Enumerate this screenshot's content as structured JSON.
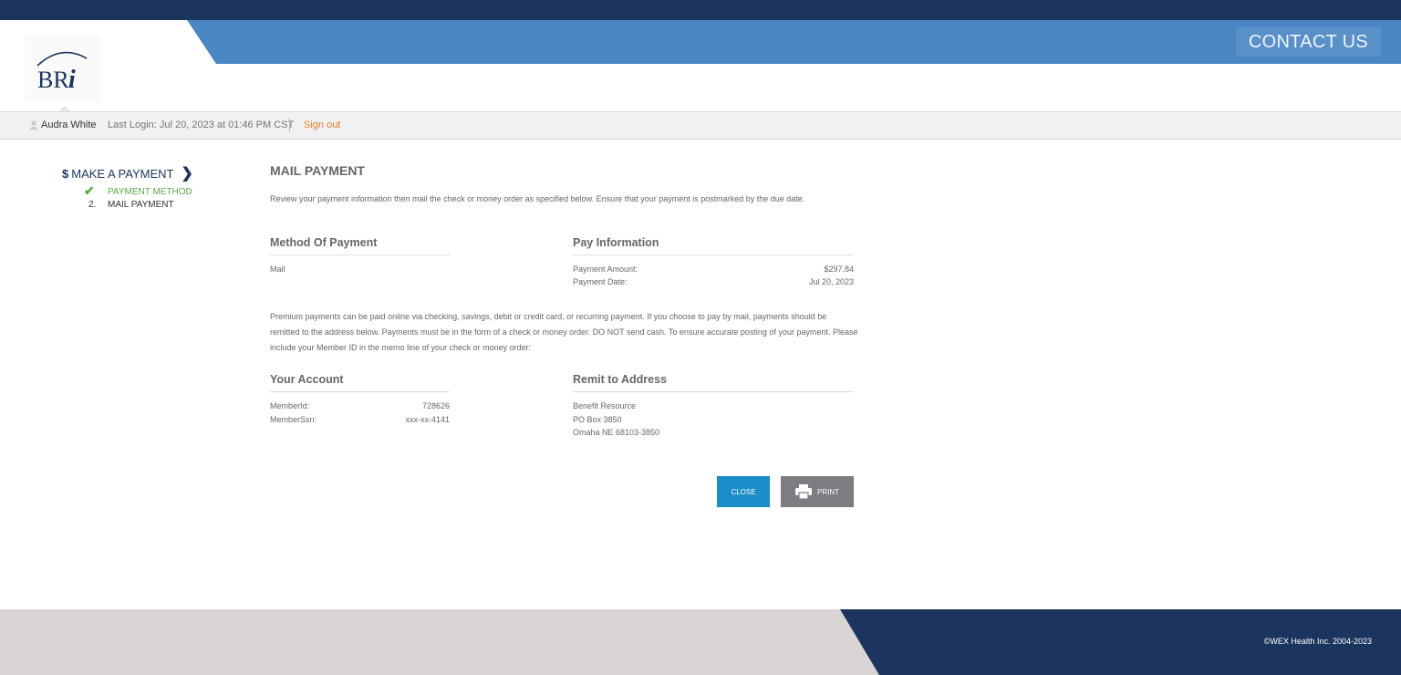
{
  "header": {
    "contact_label": "CONTACT US",
    "logo_text": "BRi"
  },
  "userbar": {
    "user_name": "Audra White",
    "last_login": "Last Login: Jul 20, 2023 at 01:46 PM CST",
    "sign_out": "Sign out"
  },
  "sidebar": {
    "dollar": "$",
    "heading": "MAKE A PAYMENT",
    "steps": [
      {
        "marker": "✔",
        "label": "PAYMENT METHOD"
      },
      {
        "marker": "2.",
        "label": "MAIL PAYMENT"
      }
    ]
  },
  "main": {
    "title": "MAIL PAYMENT",
    "intro": "Review your payment information then mail the check or money order as specified below. Ensure that your payment is postmarked by the due date.",
    "method": {
      "heading": "Method Of Payment",
      "value": "Mail"
    },
    "pay_info": {
      "heading": "Pay Information",
      "amount_label": "Payment Amount:",
      "amount_value": "$297.84",
      "date_label": "Payment Date:",
      "date_value": "Jul 20, 2023"
    },
    "paragraph": "Premium payments can be paid online via checking, savings, debit or credit card, or recurring payment. If you choose to pay by mail, payments should be remitted to the address below. Payments must be in the form of a check or money order. DO NOT send cash. To ensure accurate posting of your payment. Please include your Member ID in the memo line of your check or money order:",
    "account": {
      "heading": "Your Account",
      "member_id_label": "MemberId:",
      "member_id_value": "728626",
      "member_ssn_label": "MemberSsn:",
      "member_ssn_value": "xxx-xx-4141"
    },
    "remit": {
      "heading": "Remit to Address",
      "line1": "Benefit Resource",
      "line2": "PO Box 3850",
      "line3": "Omaha NE 68103-3850"
    },
    "close_label": "CLOSE",
    "print_label": "PRINT"
  },
  "footer": {
    "copyright": "©WEX Health Inc. 2004-2023"
  },
  "colors": {
    "navy": "#1c355e",
    "accent_blue": "#4a86c3",
    "close_button": "#1b8ec9",
    "print_button": "#7c7d80",
    "sign_out": "#e87d2d",
    "step_done": "#5aab46"
  }
}
